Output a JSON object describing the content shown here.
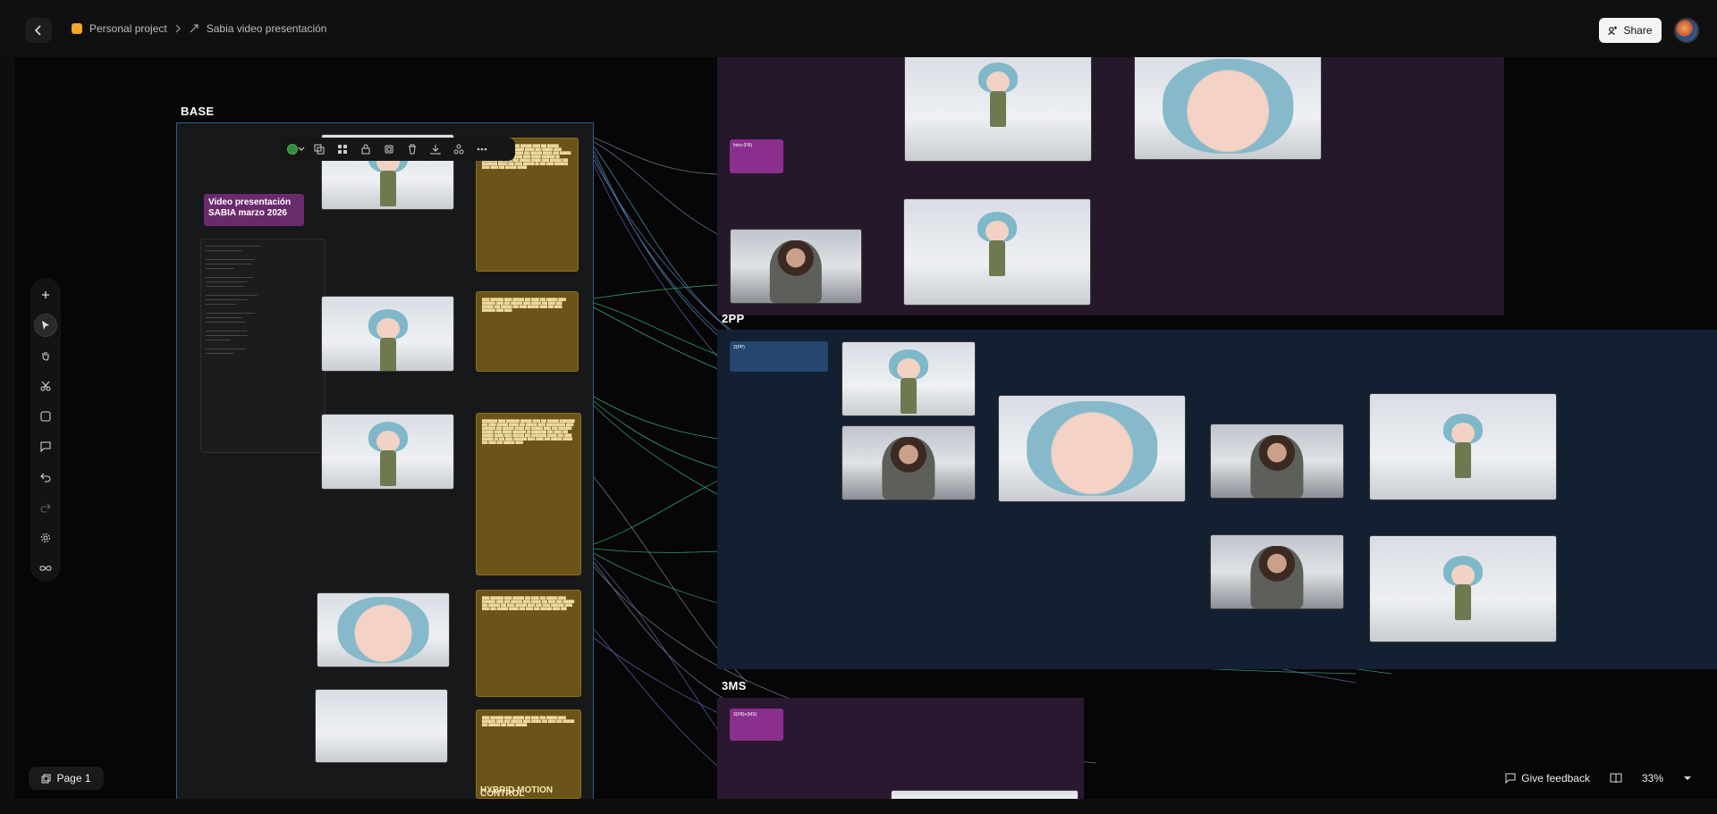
{
  "header": {
    "breadcrumb_project": "Personal project",
    "breadcrumb_file": "Sabia video presentación",
    "share_label": "Share"
  },
  "frames": {
    "base": "BASE",
    "pp2": "2PP",
    "ms3": "3MS"
  },
  "base_cards": {
    "title_card": "Video presentación SABIA marzo 2026",
    "prompt_hybrid": "HYBRID MOTION CONTROL"
  },
  "chips": {
    "purple_chip": "Intro (FB)",
    "blue_chip": "2(PP)",
    "ms_chip": "3(FB)+(MS)"
  },
  "footer": {
    "page_label": "Page 1",
    "feedback_label": "Give feedback",
    "zoom": "33%"
  }
}
